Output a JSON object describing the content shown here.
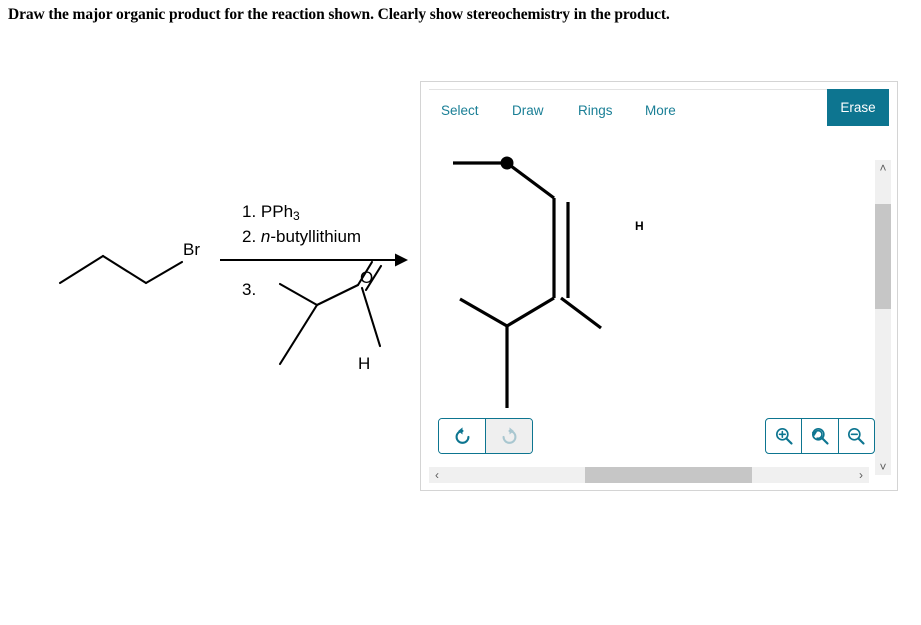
{
  "prompt": {
    "text": "Draw the major organic product for the reaction shown. Clearly show stereochemistry in the product."
  },
  "reaction": {
    "reactant": {
      "name": "1-bromopropane",
      "label_br": "Br"
    },
    "reagents": [
      {
        "number": "1.",
        "text": "PPh",
        "subscript": "3"
      },
      {
        "number": "2.",
        "italic_prefix": "n",
        "text": "-butyllithium"
      },
      {
        "number": "3.",
        "text": ""
      }
    ],
    "reagent_line_1_full": "1. PPh3",
    "reagent_line_2_full": "2. n-butyllithium",
    "reagent_line_3_full": "3.",
    "aldehyde": {
      "name": "2-methylpropanal",
      "label_o": "O",
      "label_h": "H"
    },
    "arrow": "reaction-arrow"
  },
  "editor": {
    "tabs": [
      {
        "id": "select",
        "label": "Select",
        "active": true
      },
      {
        "id": "draw",
        "label": "Draw",
        "active": false
      },
      {
        "id": "rings",
        "label": "Rings",
        "active": false
      },
      {
        "id": "more",
        "label": "More",
        "active": false
      }
    ],
    "erase_label": "Erase",
    "colors": {
      "accent": "#0d7590",
      "tab_text": "#1a7f96",
      "disabled": "#a9c7d0",
      "panel_border": "#d4d4d4",
      "scrollbar_track": "#f0f0f0",
      "scrollbar_thumb": "#c6c6c6"
    },
    "history": {
      "undo_label": "undo-arrow-icon",
      "redo_label": "redo-arrow-icon",
      "undo_enabled": true,
      "redo_enabled": false
    },
    "zoom": {
      "zoom_in_label": "zoom-in-icon",
      "zoom_reset_label": "zoom-reset-icon",
      "zoom_out_label": "zoom-out-icon"
    },
    "scrollbars": {
      "h_left": "‹",
      "h_right": "›",
      "v_up": "˄",
      "v_down": "˅"
    },
    "drawing": {
      "description": "partially drawn alkene product with isopropyl group",
      "label_h": "H",
      "has_vertex_marker": true
    }
  }
}
